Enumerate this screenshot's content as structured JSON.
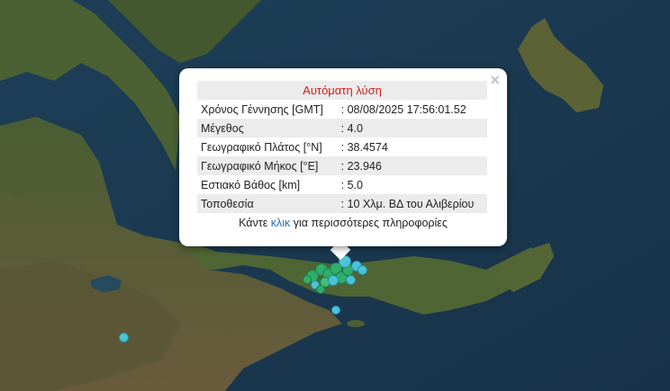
{
  "popup": {
    "title": "Αυτόματη λύση",
    "close_symbol": "×",
    "rows": [
      {
        "label": "Χρόνος Γέννησης [GMT]",
        "value": ": 08/08/2025 17:56:01.52"
      },
      {
        "label": "Μέγεθος",
        "value": ": 4.0"
      },
      {
        "label": "Γεωγραφικό Πλάτος [°N]",
        "value": ": 38.4574"
      },
      {
        "label": "Γεωγραφικό Μήκος [°E]",
        "value": ": 23.946"
      },
      {
        "label": "Εστιακό Βάθος [km]",
        "value": ": 5.0"
      },
      {
        "label": "Τοποθεσία",
        "value": ": 10 Χλμ. ΒΔ του Αλιβερίου"
      }
    ],
    "more_prefix": "Κάντε ",
    "more_link": "κλικ",
    "more_suffix": " για περισσότερες πληροφορίες"
  },
  "colors": {
    "sea": "#1b3a52",
    "land_green": "#3d5a2e",
    "land_brown": "#6b5a3c",
    "marker_green": "#2fae6a",
    "marker_cyan": "#4cc3d8",
    "title_red": "#cc1e1e",
    "link_blue": "#2a6fb5"
  }
}
